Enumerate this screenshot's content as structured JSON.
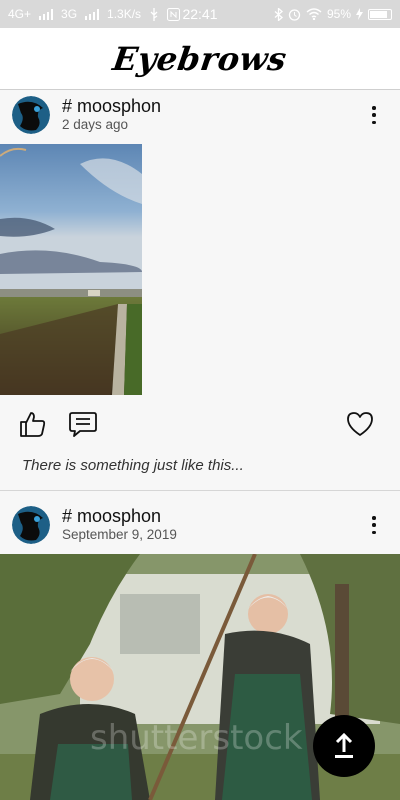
{
  "status_bar": {
    "signal_1": "4G+",
    "signal_2": "3G",
    "speed": "1.3K/s",
    "time": "22:41",
    "battery": "95%"
  },
  "header": {
    "title": "Eyebrows"
  },
  "posts": [
    {
      "username": "# moosphon",
      "date": "2 days ago",
      "caption": "There is something just like this..."
    },
    {
      "username": "# moosphon",
      "date": "September 9, 2019"
    }
  ],
  "icons": {
    "like": "thumbs-up-icon",
    "comment": "comment-icon",
    "favorite": "heart-icon",
    "more": "more-vertical-icon",
    "upload": "upload-icon"
  }
}
